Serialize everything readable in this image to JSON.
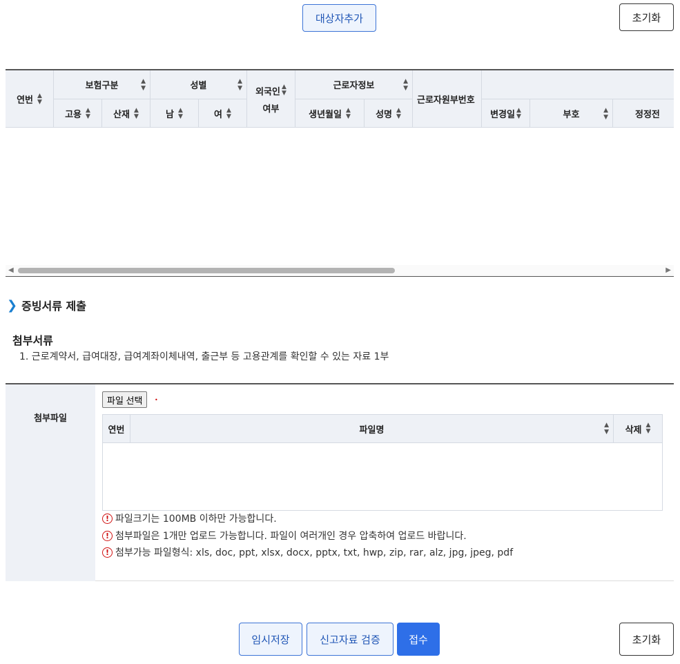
{
  "top_actions": {
    "add_target": "대상자추가",
    "reset": "초기화"
  },
  "grid": {
    "columns": {
      "seq": "연번",
      "insurance": "보험구분",
      "employment": "고용",
      "industrial": "산재",
      "gender": "성별",
      "male": "남",
      "female": "여",
      "foreigner_1": "외국인",
      "foreigner_2": "여부",
      "worker_info": "근로자정보",
      "birth_date": "생년월일",
      "name": "성명",
      "worker_id": "근로자원부번호",
      "change_date": "변경일",
      "code": "부호",
      "before_correction": "정정전"
    }
  },
  "evidence": {
    "section_title": "증빙서류 제출",
    "attachments_title": "첨부서류",
    "attachments_item": "1. 근로계약서, 급여대장, 급여계좌이체내역, 출근부 등 고용관계를 확인할 수 있는 자료 1부",
    "file_label": "첨부파일",
    "choose_file": "파일 선택",
    "file_table": {
      "seq": "연번",
      "filename": "파일명",
      "delete": "삭제"
    },
    "notes": [
      "파일크기는 100MB 이하만 가능합니다.",
      "첨부파일은 1개만 업로드 가능합니다. 파일이 여러개인 경우 압축하여 업로드 바랍니다.",
      "첨부가능 파일형식: xls, doc, ppt, xlsx, docx, pptx, txt, hwp, zip, rar, alz, jpg, jpeg, pdf"
    ],
    "warn_glyph": "!"
  },
  "bottom_actions": {
    "temp_save": "임시저장",
    "validate": "신고자료 검증",
    "submit": "접수",
    "reset": "초기화"
  },
  "colors": {
    "accent": "#2e6fe8",
    "header_bg": "#eef1f6",
    "warning": "#d01010"
  }
}
